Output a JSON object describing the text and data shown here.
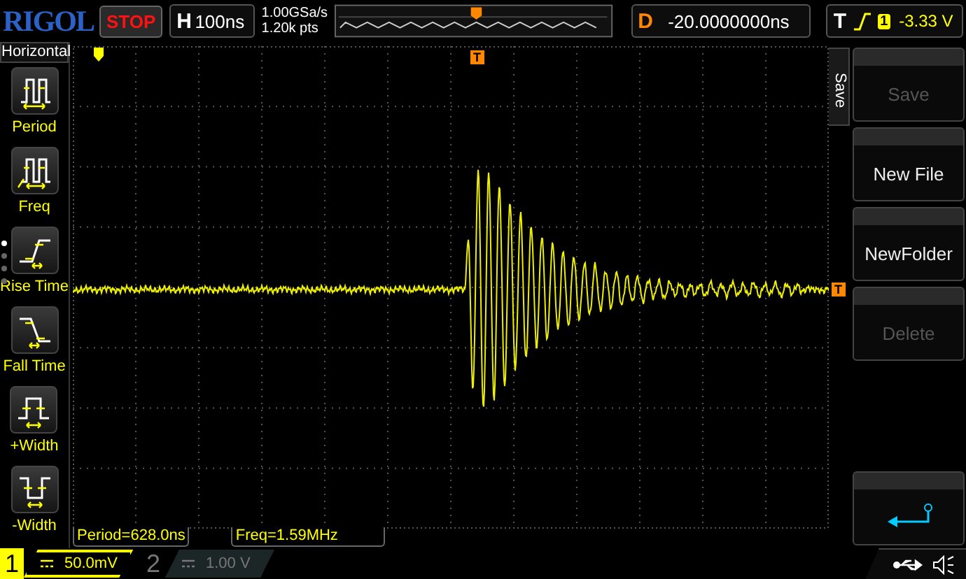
{
  "brand": "RIGOL",
  "run_state": {
    "label": "STOP",
    "running": false
  },
  "timebase": {
    "label": "H",
    "value": "100ns"
  },
  "acquisition": {
    "sample_rate": "1.00GSa/s",
    "memory_depth": "1.20k pts"
  },
  "delay": {
    "label": "D",
    "value": "-20.0000000ns"
  },
  "trigger": {
    "label": "T",
    "rising_edge": true,
    "source": "1",
    "level": "-3.33 V"
  },
  "sidebar": {
    "title": "Horizontal",
    "pages": [
      {
        "selected": true
      },
      {
        "selected": false
      },
      {
        "selected": false
      },
      {
        "selected": false
      }
    ],
    "items": [
      {
        "kind": "period",
        "label": "Period"
      },
      {
        "kind": "freq",
        "label": "Freq"
      },
      {
        "kind": "rise",
        "label": "Rise Time"
      },
      {
        "kind": "fall",
        "label": "Fall Time"
      },
      {
        "kind": "pwidth",
        "label": "+Width"
      },
      {
        "kind": "nwidth",
        "label": "-Width"
      }
    ]
  },
  "markers": {
    "trigger_position": "T",
    "trigger_level": "T"
  },
  "measurements": [
    {
      "text": "Period=628.0ns"
    },
    {
      "text": "Freq=1.59MHz"
    }
  ],
  "menu": {
    "title": "Save",
    "buttons": [
      {
        "kind": "text",
        "label": "Save",
        "disabled": true
      },
      {
        "kind": "text",
        "label": "New File",
        "disabled": false
      },
      {
        "kind": "text",
        "label": "NewFolder",
        "disabled": false
      },
      {
        "kind": "text",
        "label": "Delete",
        "disabled": true
      },
      {
        "kind": "return"
      }
    ]
  },
  "channels": [
    {
      "number": "1",
      "scale": "50.0mV",
      "enabled": true
    },
    {
      "number": "2",
      "scale": "1.00 V",
      "enabled": false
    }
  ]
}
